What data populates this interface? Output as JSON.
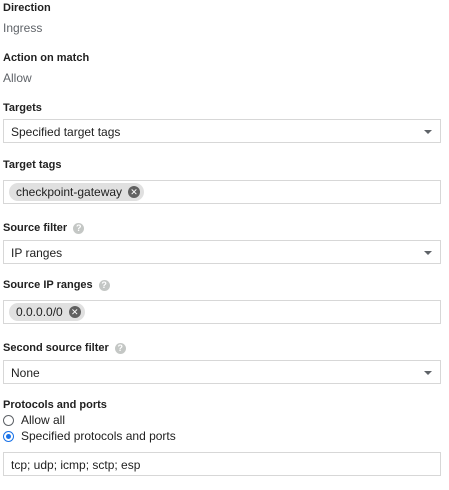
{
  "direction": {
    "label": "Direction",
    "value": "Ingress"
  },
  "action": {
    "label": "Action on match",
    "value": "Allow"
  },
  "targets": {
    "label": "Targets",
    "selected": "Specified target tags"
  },
  "target_tags": {
    "label": "Target tags",
    "chip": "checkpoint-gateway"
  },
  "source_filter": {
    "label": "Source filter",
    "selected": "IP ranges"
  },
  "source_ip_ranges": {
    "label": "Source IP ranges",
    "chip": "0.0.0.0/0"
  },
  "second_source_filter": {
    "label": "Second source filter",
    "selected": "None"
  },
  "protocols": {
    "label": "Protocols and ports",
    "options": [
      "Allow all",
      "Specified protocols and ports"
    ],
    "selected_index": 1,
    "value": "tcp; udp; icmp; sctp; esp"
  },
  "icons": {
    "help": "help-icon",
    "dropdown": "chevron-down-icon",
    "chip_remove": "close-icon"
  },
  "colors": {
    "accent": "#1a73e8",
    "chip_bg": "#e0e0e0",
    "border": "#d7d7d7",
    "label_gray": "#5f6368"
  }
}
